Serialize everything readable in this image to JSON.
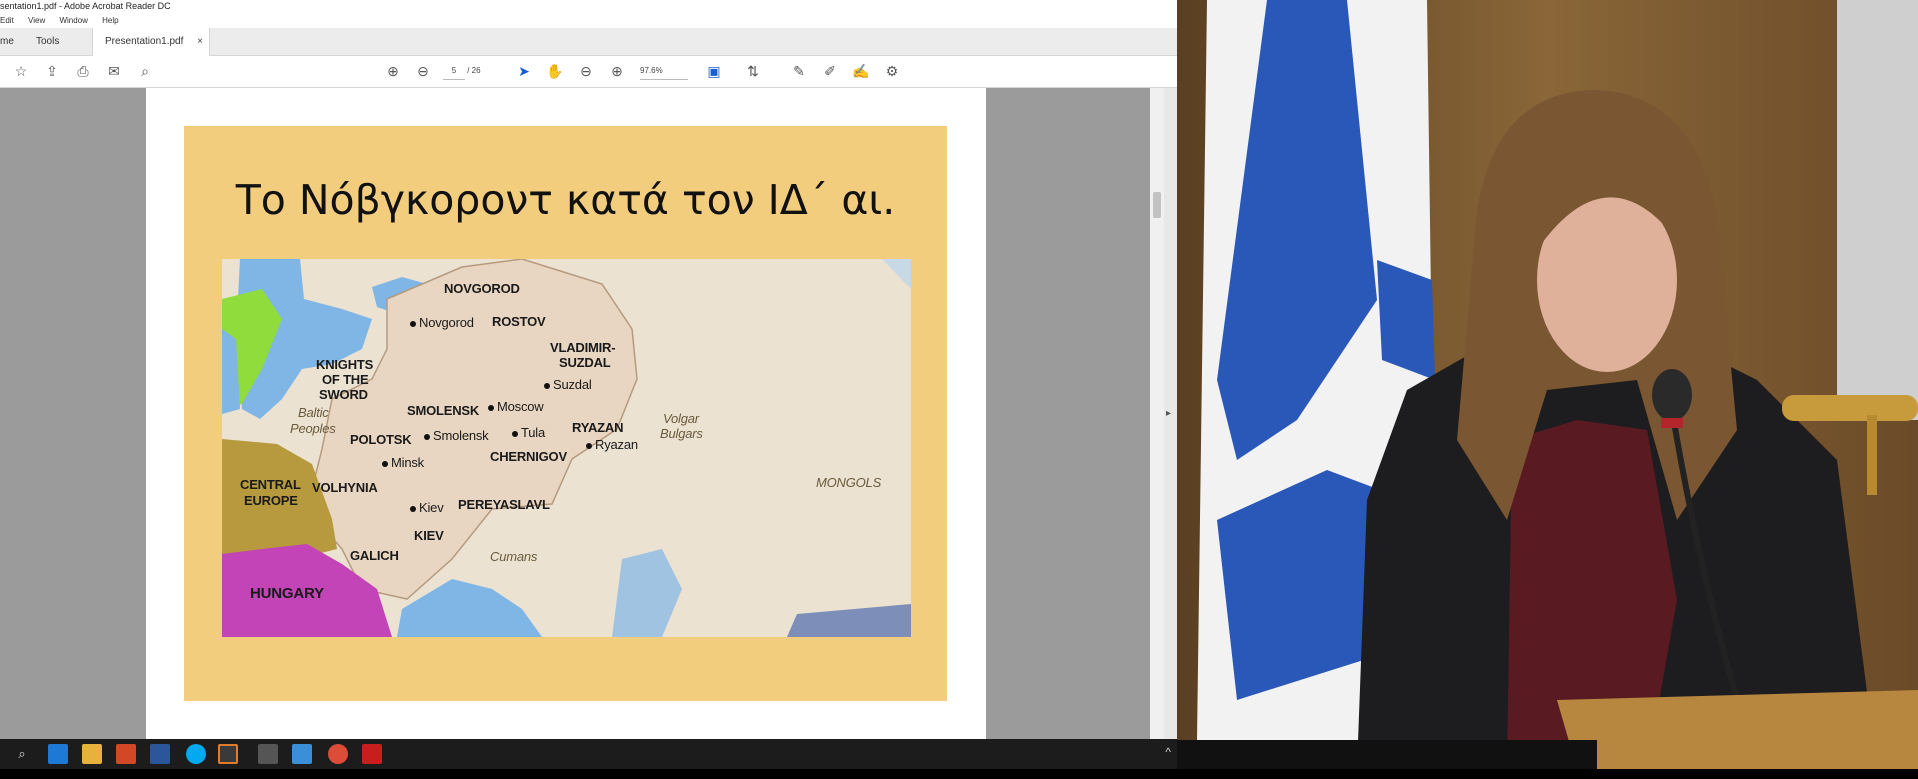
{
  "window": {
    "title": "sentation1.pdf - Adobe Acrobat Reader DC",
    "menu": [
      "Edit",
      "View",
      "Window",
      "Help"
    ]
  },
  "tabs": {
    "home": "me",
    "tools": "Tools",
    "document": "Presentation1.pdf",
    "close": "×"
  },
  "toolbar": {
    "page_current": "5",
    "page_total": "/ 26",
    "zoom": "97.6%"
  },
  "slide": {
    "title": "Το Νόβγκοροντ κατά τον ΙΔ΄ αι."
  },
  "map": {
    "regions": [
      "NOVGOROD",
      "ROSTOV",
      "VLADIMIR-",
      "SUZDAL",
      "KNIGHTS",
      "OF THE",
      "SWORD",
      "SMOLENSK",
      "POLOTSK",
      "RYAZAN",
      "CHERNIGOV",
      "VOLHYNIA",
      "CENTRAL",
      "EUROPE",
      "PEREYASLAVL",
      "KIEV",
      "GALICH",
      "HUNGARY",
      "MONGOLS"
    ],
    "cities": [
      "Novgorod",
      "Suzdal",
      "Moscow",
      "Smolensk",
      "Tula",
      "Ryazan",
      "Minsk",
      "Kiev"
    ],
    "peoples": [
      "Baltic",
      "Peoples",
      "Volgar",
      "Bulgars",
      "Cumans"
    ]
  },
  "colors": {
    "slide_bg": "#f3cd7e",
    "russia_fill": "#e8d6c2",
    "sea": "#7fb6e6",
    "hungary": "#c244b6",
    "central_europe": "#b79a3e",
    "green": "#8fdc3c"
  },
  "taskbar_icons": [
    "search-icon",
    "edge-icon",
    "file-explorer-icon",
    "powerpoint-icon",
    "word-icon",
    "skype-icon",
    "firefox-icon",
    "media-icon",
    "app-icon",
    "chrome-icon",
    "acrobat-icon"
  ]
}
